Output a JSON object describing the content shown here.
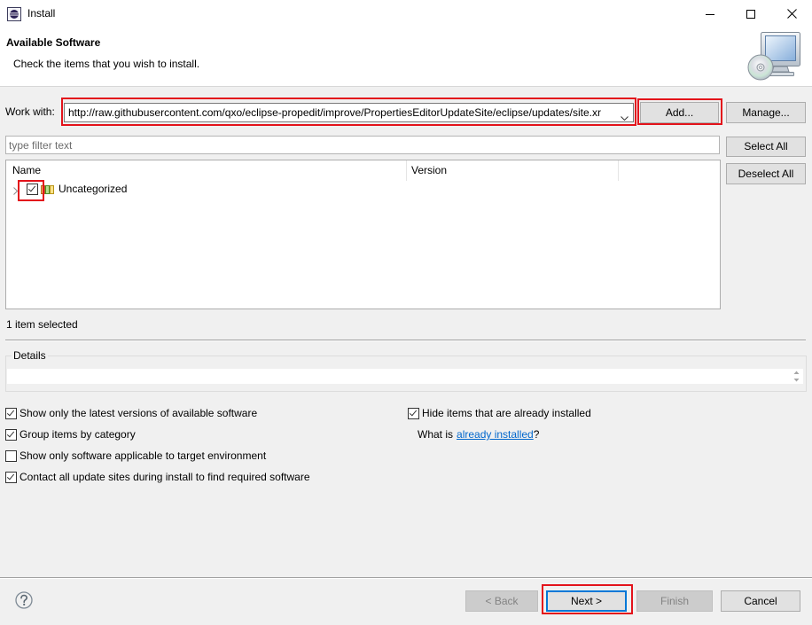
{
  "window": {
    "title": "Install",
    "icon": "eclipse-icon",
    "controls": [
      "minimize-icon",
      "maximize-icon",
      "close-icon"
    ]
  },
  "header": {
    "title": "Available Software",
    "subtitle": "Check the items that you wish to install.",
    "banner_icon": "install-monitor-cd-icon"
  },
  "work_with": {
    "label": "Work with:",
    "url": "http://raw.githubusercontent.com/qxo/eclipse-propedit/improve/PropertiesEditorUpdateSite/eclipse/updates/site.xr",
    "add_label": "Add...",
    "manage_label": "Manage..."
  },
  "filter": {
    "placeholder": "type filter text"
  },
  "selection_buttons": {
    "select_all": "Select All",
    "deselect_all": "Deselect All"
  },
  "software_tree": {
    "columns": [
      "Name",
      "Version"
    ],
    "rows": [
      {
        "name": "Uncategorized",
        "checked": true,
        "expanded": false,
        "icon": "category-icon"
      }
    ]
  },
  "status": "1 item selected",
  "details": {
    "label": "Details"
  },
  "options": [
    {
      "label": "Show only the latest versions of available software",
      "checked": true
    },
    {
      "label": "Group items by category",
      "checked": true
    },
    {
      "label": "Show only software applicable to target environment",
      "checked": false
    },
    {
      "label": "Contact all update sites during install to find required software",
      "checked": true
    }
  ],
  "hide_installed": {
    "label": "Hide items that are already installed",
    "checked": true
  },
  "what_is": {
    "prefix": "What is",
    "link": "already installed",
    "suffix": "?"
  },
  "footer": {
    "help_icon": "help-icon",
    "back": {
      "label": "< Back",
      "enabled": false
    },
    "next": {
      "label": "Next >",
      "enabled": true,
      "default": true
    },
    "finish": {
      "label": "Finish",
      "enabled": false
    },
    "cancel": {
      "label": "Cancel",
      "enabled": true
    }
  },
  "colors": {
    "highlight": "#e3131b",
    "link": "#0066cc",
    "default_button_border": "#0078d7",
    "background": "#f0f0f0"
  }
}
